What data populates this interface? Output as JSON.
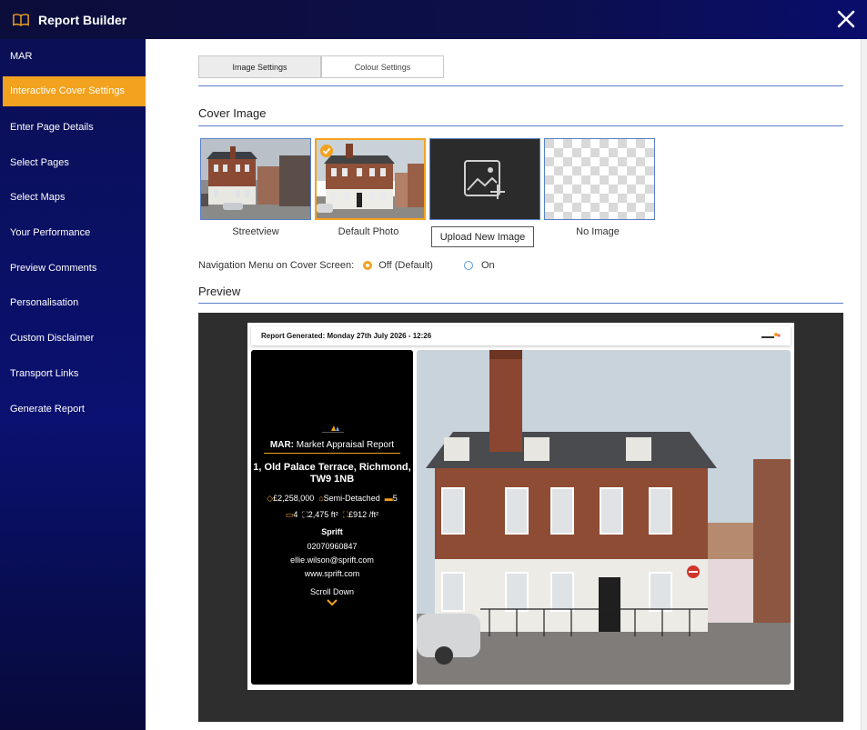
{
  "app": {
    "title": "Report Builder"
  },
  "sidebar": {
    "items": [
      {
        "label": "MAR"
      },
      {
        "label": "Interactive Cover Settings",
        "active": true
      },
      {
        "label": "Enter Page Details"
      },
      {
        "label": "Select Pages"
      },
      {
        "label": "Select Maps"
      },
      {
        "label": "Your Performance"
      },
      {
        "label": "Preview Comments"
      },
      {
        "label": "Personalisation"
      },
      {
        "label": "Custom Disclaimer"
      },
      {
        "label": "Transport Links"
      },
      {
        "label": "Generate Report"
      }
    ]
  },
  "tabs": [
    {
      "label": "Image Settings",
      "active": true
    },
    {
      "label": "Colour Settings"
    }
  ],
  "cover_image": {
    "title": "Cover Image",
    "options": [
      {
        "label": "Streetview"
      },
      {
        "label": "Default Photo",
        "selected": true
      },
      {
        "label": "Upload New Image"
      },
      {
        "label": "No Image"
      }
    ]
  },
  "navigation_menu": {
    "label": "Navigation Menu on Cover Screen:",
    "options": [
      {
        "label": "Off (Default)",
        "selected": true
      },
      {
        "label": "On"
      }
    ]
  },
  "preview": {
    "title": "Preview",
    "header": "Report Generated: Monday 27th July 2026 - 12:26",
    "report_prefix": "MAR:",
    "report_title": "Market Appraisal Report",
    "address_line1": "1, Old Palace Terrace, Richmond,",
    "address_line2": "TW9 1NB",
    "price": "£2,258,000",
    "property_type": "Semi-Detached",
    "bedrooms": "5",
    "bathrooms": "4",
    "area": "2,475 ft²",
    "price_per_area": "£912 /ft²",
    "agent_name": "Sprift",
    "phone": "02070960847",
    "email": "ellie.wilson@sprift.com",
    "website": "www.sprift.com",
    "scroll_label": "Scroll Down"
  },
  "colors": {
    "accent": "#f3a21f",
    "navy": "#0b0f55",
    "line": "#5a7fc9"
  }
}
